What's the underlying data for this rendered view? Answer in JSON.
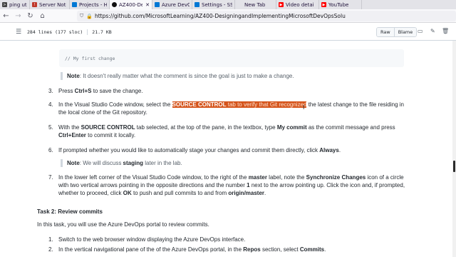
{
  "browser": {
    "tabs": [
      {
        "label": "ping util com",
        "icon": "terminal-icon",
        "color": "#444444",
        "active": false
      },
      {
        "label": "Server Not F",
        "icon": "warning-icon",
        "color": "#c0392b",
        "active": false
      },
      {
        "label": "Projects - H",
        "icon": "azure-devops-icon",
        "color": "#0078d4",
        "active": false
      },
      {
        "label": "AZ400-De",
        "icon": "github-icon",
        "color": "#111111",
        "active": true
      },
      {
        "label": "Azure DevO",
        "icon": "azure-devops-icon",
        "color": "#0078d4",
        "active": false
      },
      {
        "label": "Settings - SS",
        "icon": "azure-devops-icon",
        "color": "#0078d4",
        "active": false
      },
      {
        "label": "New Tab",
        "icon": "newtab-icon",
        "color": "#888888",
        "active": false
      },
      {
        "label": "Video detai",
        "icon": "youtube-icon",
        "color": "#ff0000",
        "active": false
      },
      {
        "label": "YouTube",
        "icon": "youtube-icon",
        "color": "#ff0000",
        "active": false
      }
    ],
    "url": "https://github.com/MicrosoftLearning/AZ400-DesigningandImplementingMicrosoftDevOpsSolu"
  },
  "file_header": {
    "lines": "284 lines (177 sloc)",
    "size": "21.7 KB",
    "raw_label": "Raw",
    "blame_label": "Blame"
  },
  "content": {
    "code_comment": "// My first change",
    "note1_label": "Note",
    "note1_text": ": It doesn't really matter what the comment is since the goal is just to make a change.",
    "item3": {
      "num": "3.",
      "pre": "Press ",
      "key": "Ctrl+S",
      "post": " to save the change."
    },
    "item4": {
      "num": "4.",
      "pre": "In the Visual Studio Code window, select the ",
      "hl_bold": "SOURCE CONTROL",
      "hl_rest": " tab to verify that Git recognized",
      "post": " the latest change to the file residing in",
      "line2": "the local clone of the Git repository."
    },
    "item5": {
      "num": "5.",
      "t1": "With the ",
      "b1": "SOURCE CONTROL",
      "t2": " tab selected, at the top of the pane, in the textbox, type ",
      "b2": "My commit",
      "t3": " as the commit message and press",
      "b3": "Ctrl+Enter",
      "t4": " to commit it locally."
    },
    "item6": {
      "num": "6.",
      "t1": "If prompted whether you would like to automatically stage your changes and commit them directly, click ",
      "b1": "Always",
      "t2": "."
    },
    "note2": {
      "label": "Note",
      "t1": ": We will discuss ",
      "b1": "staging",
      "t2": " later in the lab."
    },
    "item7": {
      "num": "7.",
      "l1a": "In the lower left corner of the Visual Studio Code window, to the right of the ",
      "l1b": "master",
      "l1c": " label, note the ",
      "l1d": "Synchronize Changes",
      "l1e": " icon of a circle",
      "l2a": "with two vertical arrows pointing in the opposite directions and the number ",
      "l2b": "1",
      "l2c": " next to the arrow pointing up. Click the icon and, if prompted,",
      "l3a": "whether to proceed, click ",
      "l3b": "OK",
      "l3c": " to push and pull commits to and from ",
      "l3d": "origin/master",
      "l3e": "."
    },
    "task2_title": "Task 2: Review commits",
    "task2_intro": "In this task, you will use the Azure DevOps portal to review commits.",
    "t2_item1": {
      "num": "1.",
      "text": "Switch to the web browser window displaying the Azure DevOps interface."
    },
    "t2_item2": {
      "num": "2.",
      "t1": "In the vertical navigational pane of the of the Azure DevOps portal, in the ",
      "b1": "Repos",
      "t2": " section, select ",
      "b2": "Commits",
      "t3": "."
    }
  }
}
